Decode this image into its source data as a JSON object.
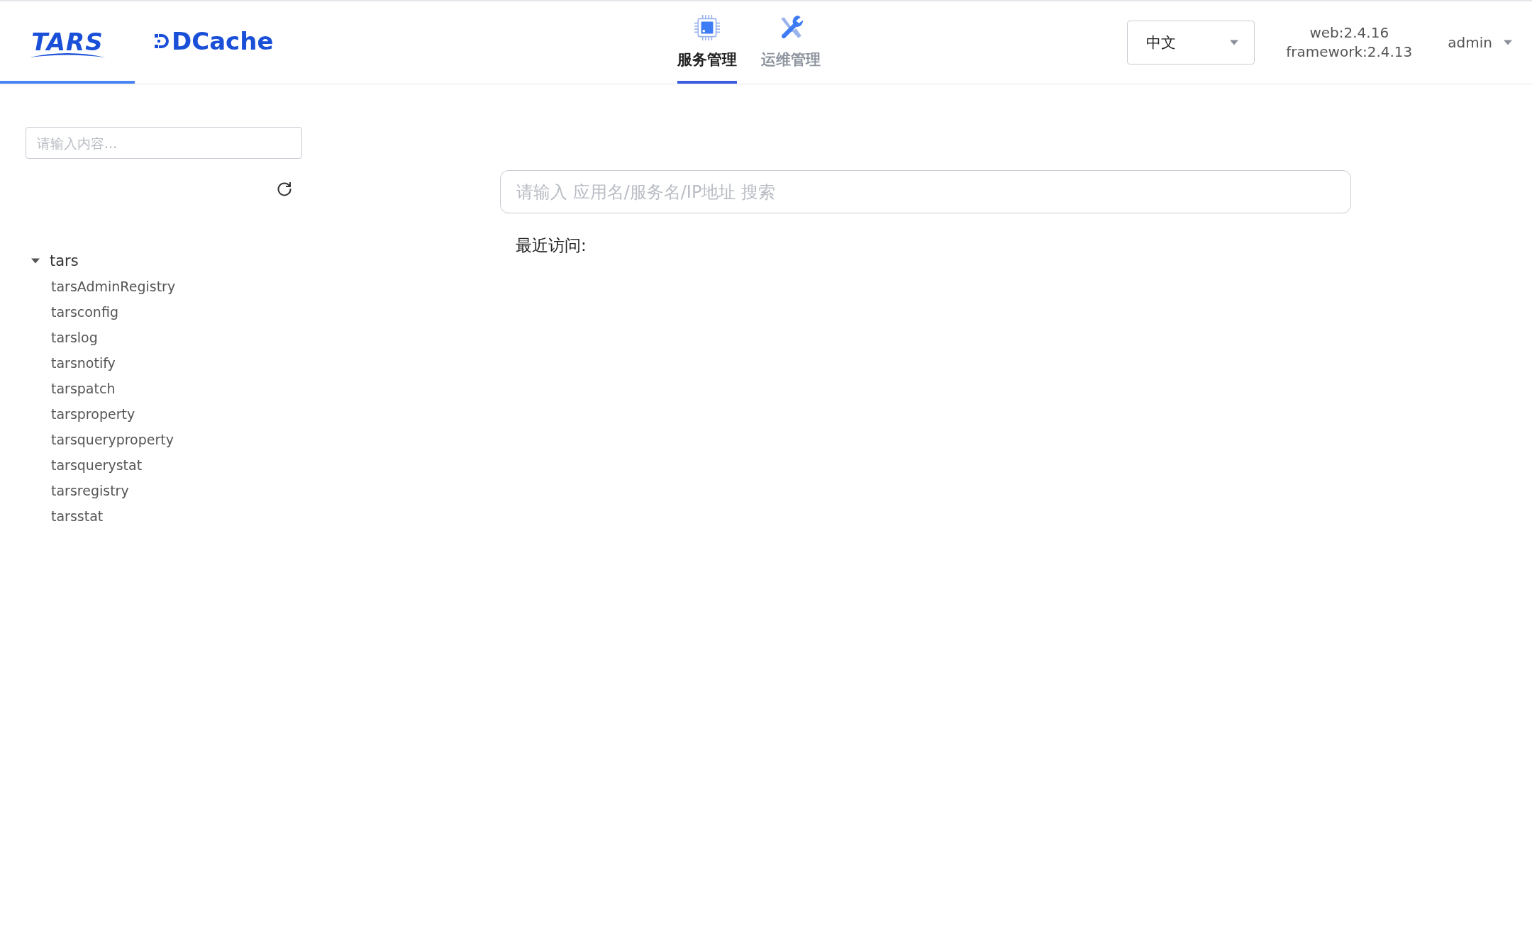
{
  "brand_tabs": [
    {
      "label": "TARS",
      "kind": "tars",
      "selected": true
    },
    {
      "label": "DCache",
      "kind": "dcache",
      "selected": false
    }
  ],
  "nav_tabs": [
    {
      "label": "服务管理",
      "kind": "chip",
      "selected": true
    },
    {
      "label": "运维管理",
      "kind": "tools",
      "selected": false
    }
  ],
  "language_select": {
    "value": "中文"
  },
  "versions": [
    "web:2.4.16",
    "framework:2.4.13"
  ],
  "user_menu": {
    "label": "admin"
  },
  "sidebar": {
    "search": {
      "placeholder": "请输入内容..."
    },
    "tree": [
      {
        "label": "tars",
        "expanded": true,
        "children": [
          {
            "label": "tarsAdminRegistry"
          },
          {
            "label": "tarsconfig"
          },
          {
            "label": "tarslog"
          },
          {
            "label": "tarsnotify"
          },
          {
            "label": "tarspatch"
          },
          {
            "label": "tarsproperty"
          },
          {
            "label": "tarsqueryproperty"
          },
          {
            "label": "tarsquerystat"
          },
          {
            "label": "tarsregistry"
          },
          {
            "label": "tarsstat"
          }
        ]
      }
    ]
  },
  "main": {
    "search": {
      "placeholder": "请输入 应用名/服务名/IP地址 搜索"
    },
    "recent_label": "最近访问:"
  }
}
